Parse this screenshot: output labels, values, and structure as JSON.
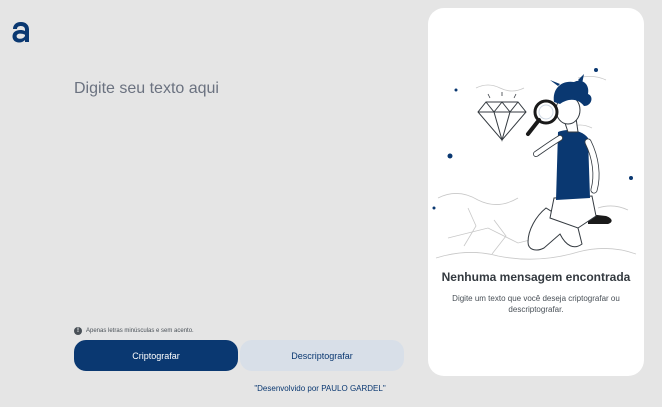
{
  "input": {
    "placeholder": "Digite seu texto aqui"
  },
  "hint": {
    "icon": "info-icon",
    "text": "Apenas letras minúsculas e sem acento."
  },
  "buttons": {
    "encrypt_label": "Criptografar",
    "decrypt_label": "Descriptografar"
  },
  "footer": {
    "text": "\"Desenvolvido por PAULO GARDEL\""
  },
  "result_panel": {
    "title": "Nenhuma mensagem encontrada",
    "description": "Digite um texto que você deseja criptografar ou descriptografar."
  },
  "colors": {
    "brand": "#0a3871",
    "background": "#e5e5e5",
    "secondary_button": "#d8dfe8"
  }
}
